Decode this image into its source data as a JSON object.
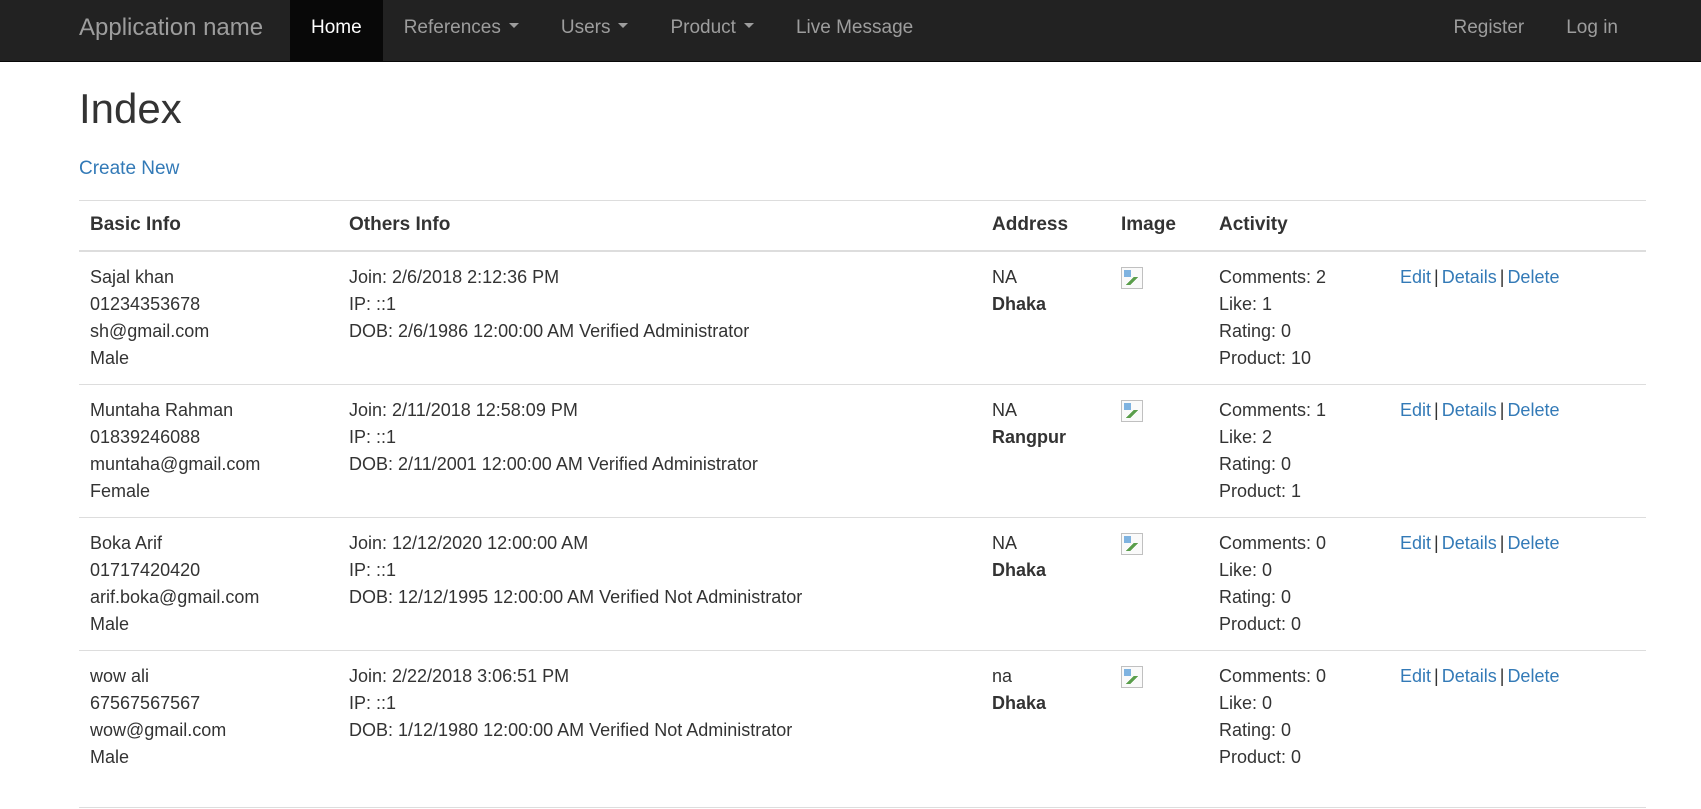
{
  "navbar": {
    "brand": "Application name",
    "items": [
      {
        "label": "Home",
        "active": true,
        "dropdown": false
      },
      {
        "label": "References",
        "active": false,
        "dropdown": true
      },
      {
        "label": "Users",
        "active": false,
        "dropdown": true
      },
      {
        "label": "Product",
        "active": false,
        "dropdown": true
      },
      {
        "label": "Live Message",
        "active": false,
        "dropdown": false
      }
    ],
    "right": [
      {
        "label": "Register"
      },
      {
        "label": "Log in"
      }
    ]
  },
  "page": {
    "title": "Index",
    "create_new": "Create New"
  },
  "table": {
    "headers": [
      "Basic Info",
      "Others Info",
      "Address",
      "Image",
      "Activity",
      ""
    ],
    "action_labels": {
      "edit": "Edit",
      "details": "Details",
      "delete": "Delete",
      "separator": "|"
    },
    "rows": [
      {
        "name": "Sajal khan",
        "phone": "01234353678",
        "email": "sh@gmail.com",
        "gender": "Male",
        "join": "Join: 2/6/2018 2:12:36 PM",
        "ip": "IP: ::1",
        "dob": "DOB: 2/6/1986 12:00:00 AM Verified Administrator",
        "address_line": "NA",
        "city": "Dhaka",
        "comments": "Comments: 2",
        "like": "Like: 1",
        "rating": "Rating: 0",
        "product": "Product: 10"
      },
      {
        "name": "Muntaha Rahman",
        "phone": "01839246088",
        "email": "muntaha@gmail.com",
        "gender": "Female",
        "join": "Join: 2/11/2018 12:58:09 PM",
        "ip": "IP: ::1",
        "dob": "DOB: 2/11/2001 12:00:00 AM Verified Administrator",
        "address_line": "NA",
        "city": "Rangpur",
        "comments": "Comments: 1",
        "like": "Like: 2",
        "rating": "Rating: 0",
        "product": "Product: 1"
      },
      {
        "name": "Boka Arif",
        "phone": "01717420420",
        "email": "arif.boka@gmail.com",
        "gender": "Male",
        "join": "Join: 12/12/2020 12:00:00 AM",
        "ip": "IP: ::1",
        "dob": "DOB: 12/12/1995 12:00:00 AM Verified Not Administrator",
        "address_line": "NA",
        "city": "Dhaka",
        "comments": "Comments: 0",
        "like": "Like: 0",
        "rating": "Rating: 0",
        "product": "Product: 0"
      },
      {
        "name": "wow ali",
        "phone": "67567567567",
        "email": "wow@gmail.com",
        "gender": "Male",
        "join": "Join: 2/22/2018 3:06:51 PM",
        "ip": "IP: ::1",
        "dob": "DOB: 1/12/1980 12:00:00 AM Verified Not Administrator",
        "address_line": "na",
        "city": "Dhaka",
        "comments": "Comments: 0",
        "like": "Like: 0",
        "rating": "Rating: 0",
        "product": "Product: 0"
      }
    ]
  }
}
